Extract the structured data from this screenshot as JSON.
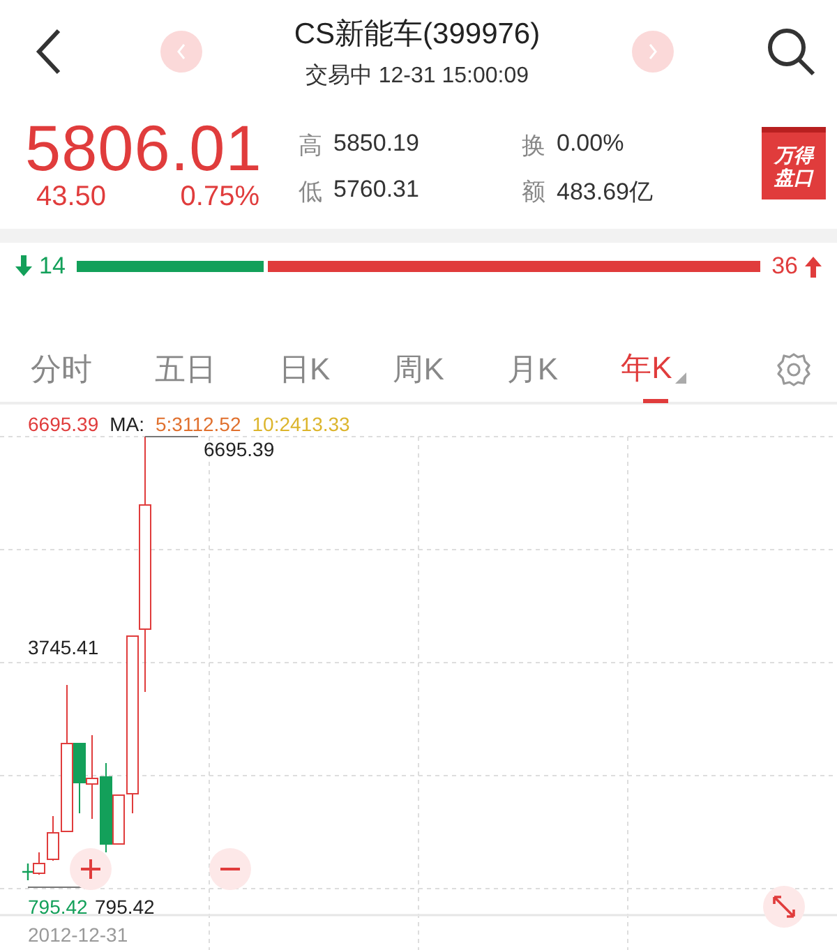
{
  "header": {
    "title": "CS新能车(399976)",
    "status": "交易中 12-31 15:00:09"
  },
  "quote": {
    "price": "5806.01",
    "change": "43.50",
    "change_pct": "0.75%",
    "badge": "万得盘口",
    "stats": [
      {
        "label": "高",
        "value": "5850.19"
      },
      {
        "label": "换",
        "value": "0.00%"
      },
      {
        "label": "低",
        "value": "5760.31"
      },
      {
        "label": "额",
        "value": "483.69亿"
      }
    ]
  },
  "breadth": {
    "down": "14",
    "up": "36",
    "level": 0.28
  },
  "tabs": [
    {
      "label": "分时",
      "selected": false,
      "dropdown": false
    },
    {
      "label": "五日",
      "selected": false,
      "dropdown": false
    },
    {
      "label": "日K",
      "selected": false,
      "dropdown": false
    },
    {
      "label": "周K",
      "selected": false,
      "dropdown": false
    },
    {
      "label": "月K",
      "selected": false,
      "dropdown": false
    },
    {
      "label": "年K",
      "selected": true,
      "dropdown": true
    }
  ],
  "chart": {
    "price": "6695.39",
    "ma_label": "MA:",
    "ma": [
      {
        "label": "5:3112.52",
        "color": "#e0702e"
      },
      {
        "label": "10:2413.33",
        "color": "#dcb52c"
      }
    ],
    "max_label": "6695.39",
    "mid_label": "3745.41",
    "cursor_label": "795.42",
    "low_label": "795.42",
    "date": "2012-12-31"
  }
}
